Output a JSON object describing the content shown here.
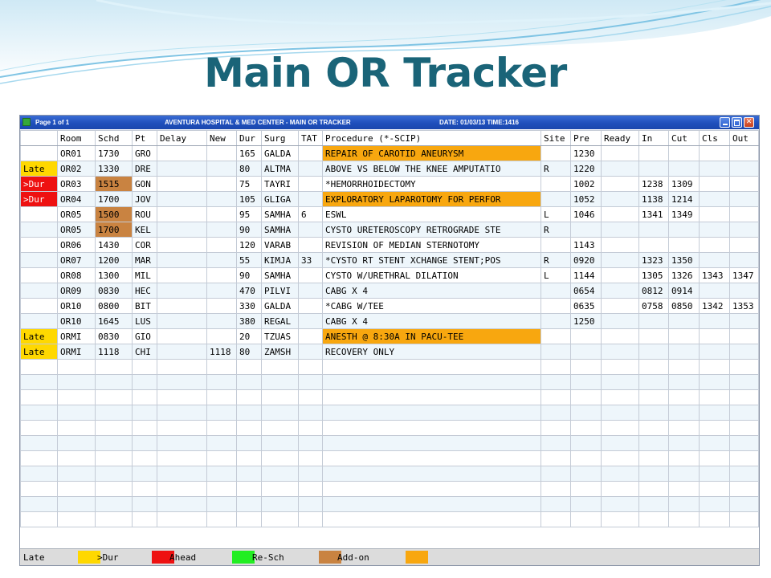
{
  "slide_title": "Main OR Tracker",
  "window": {
    "page_label": "Page 1 of 1",
    "app_title": "AVENTURA HOSPITAL & MED CENTER - MAIN OR TRACKER",
    "date_time": "DATE: 01/03/13   TIME:1416",
    "minimize_icon": "minimize-icon",
    "maximize_icon": "maximize-icon",
    "close_icon": "close-icon",
    "close_glyph": "✕"
  },
  "colors": {
    "late": "#ffd800",
    "over_duration": "#ee1111",
    "ahead": "#22ee22",
    "re_sch": "#c98341",
    "add_on": "#f8a70f",
    "title": "#1a6478",
    "titlebar": "#1f4fbc"
  },
  "columns": [
    "",
    "Room",
    "Schd",
    "Pt",
    "Delay",
    "New",
    "Dur",
    "Surg",
    "TAT",
    "Procedure (*-SCIP)",
    "Site",
    "Pre",
    "Ready",
    "In",
    "Cut",
    "Cls",
    "Out"
  ],
  "rows": [
    {
      "status": "",
      "room": "OR01",
      "schd": "1730",
      "pt": "GRO",
      "delay": "",
      "new": "",
      "dur": "165",
      "surg": "GALDA",
      "tat": "",
      "procedure": "REPAIR OF CAROTID ANEURYSM",
      "site": "",
      "pre": "1230",
      "ready": "",
      "in": "",
      "cut": "",
      "cls": "",
      "out": "",
      "status_color": "",
      "schd_color": "",
      "proc_color": "add_on"
    },
    {
      "status": "Late",
      "room": "OR02",
      "schd": "1330",
      "pt": "DRE",
      "delay": "",
      "new": "",
      "dur": "80",
      "surg": "ALTMA",
      "tat": "",
      "procedure": "ABOVE VS BELOW THE KNEE AMPUTATIO",
      "site": "R",
      "pre": "1220",
      "ready": "",
      "in": "",
      "cut": "",
      "cls": "",
      "out": "",
      "status_color": "late",
      "schd_color": "",
      "proc_color": ""
    },
    {
      "status": ">Dur",
      "room": "OR03",
      "schd": "1515",
      "pt": "GON",
      "delay": "",
      "new": "",
      "dur": "75",
      "surg": "TAYRI",
      "tat": "",
      "procedure": "*HEMORRHOIDECTOMY",
      "site": "",
      "pre": "1002",
      "ready": "",
      "in": "1238",
      "cut": "1309",
      "cls": "",
      "out": "",
      "status_color": "over_duration",
      "schd_color": "re_sch",
      "proc_color": ""
    },
    {
      "status": ">Dur",
      "room": "OR04",
      "schd": "1700",
      "pt": "JOV",
      "delay": "",
      "new": "",
      "dur": "105",
      "surg": "GLIGA",
      "tat": "",
      "procedure": "EXPLORATORY LAPAROTOMY FOR PERFOR",
      "site": "",
      "pre": "1052",
      "ready": "",
      "in": "1138",
      "cut": "1214",
      "cls": "",
      "out": "",
      "status_color": "over_duration",
      "schd_color": "",
      "proc_color": "add_on"
    },
    {
      "status": "",
      "room": "OR05",
      "schd": "1500",
      "pt": "ROU",
      "delay": "",
      "new": "",
      "dur": "95",
      "surg": "SAMHA",
      "tat": "6",
      "procedure": "ESWL",
      "site": "L",
      "pre": "1046",
      "ready": "",
      "in": "1341",
      "cut": "1349",
      "cls": "",
      "out": "",
      "status_color": "",
      "schd_color": "re_sch",
      "proc_color": ""
    },
    {
      "status": "",
      "room": "OR05",
      "schd": "1700",
      "pt": "KEL",
      "delay": "",
      "new": "",
      "dur": "90",
      "surg": "SAMHA",
      "tat": "",
      "procedure": "CYSTO URETEROSCOPY RETROGRADE STE",
      "site": "R",
      "pre": "",
      "ready": "",
      "in": "",
      "cut": "",
      "cls": "",
      "out": "",
      "status_color": "",
      "schd_color": "re_sch",
      "proc_color": ""
    },
    {
      "status": "",
      "room": "OR06",
      "schd": "1430",
      "pt": "COR",
      "delay": "",
      "new": "",
      "dur": "120",
      "surg": "VARAB",
      "tat": "",
      "procedure": "REVISION OF MEDIAN STERNOTOMY",
      "site": "",
      "pre": "1143",
      "ready": "",
      "in": "",
      "cut": "",
      "cls": "",
      "out": "",
      "status_color": "",
      "schd_color": "",
      "proc_color": ""
    },
    {
      "status": "",
      "room": "OR07",
      "schd": "1200",
      "pt": "MAR",
      "delay": "",
      "new": "",
      "dur": "55",
      "surg": "KIMJA",
      "tat": "33",
      "procedure": "*CYSTO RT STENT XCHANGE STENT;POS",
      "site": "R",
      "pre": "0920",
      "ready": "",
      "in": "1323",
      "cut": "1350",
      "cls": "",
      "out": "",
      "status_color": "",
      "schd_color": "",
      "proc_color": ""
    },
    {
      "status": "",
      "room": "OR08",
      "schd": "1300",
      "pt": "MIL",
      "delay": "",
      "new": "",
      "dur": "90",
      "surg": "SAMHA",
      "tat": "",
      "procedure": "CYSTO W/URETHRAL DILATION",
      "site": "L",
      "pre": "1144",
      "ready": "",
      "in": "1305",
      "cut": "1326",
      "cls": "1343",
      "out": "1347",
      "status_color": "",
      "schd_color": "",
      "proc_color": ""
    },
    {
      "status": "",
      "room": "OR09",
      "schd": "0830",
      "pt": "HEC",
      "delay": "",
      "new": "",
      "dur": "470",
      "surg": "PILVI",
      "tat": "",
      "procedure": "CABG X 4",
      "site": "",
      "pre": "0654",
      "ready": "",
      "in": "0812",
      "cut": "0914",
      "cls": "",
      "out": "",
      "status_color": "",
      "schd_color": "",
      "proc_color": ""
    },
    {
      "status": "",
      "room": "OR10",
      "schd": "0800",
      "pt": "BIT",
      "delay": "",
      "new": "",
      "dur": "330",
      "surg": "GALDA",
      "tat": "",
      "procedure": "*CABG W/TEE",
      "site": "",
      "pre": "0635",
      "ready": "",
      "in": "0758",
      "cut": "0850",
      "cls": "1342",
      "out": "1353",
      "status_color": "",
      "schd_color": "",
      "proc_color": ""
    },
    {
      "status": "",
      "room": "OR10",
      "schd": "1645",
      "pt": "LUS",
      "delay": "",
      "new": "",
      "dur": "380",
      "surg": "REGAL",
      "tat": "",
      "procedure": "CABG X 4",
      "site": "",
      "pre": "1250",
      "ready": "",
      "in": "",
      "cut": "",
      "cls": "",
      "out": "",
      "status_color": "",
      "schd_color": "",
      "proc_color": ""
    },
    {
      "status": "Late",
      "room": "ORMI",
      "schd": "0830",
      "pt": "GIO",
      "delay": "",
      "new": "",
      "dur": "20",
      "surg": "TZUAS",
      "tat": "",
      "procedure": "ANESTH @ 8:30A IN PACU-TEE",
      "site": "",
      "pre": "",
      "ready": "",
      "in": "",
      "cut": "",
      "cls": "",
      "out": "",
      "status_color": "late",
      "schd_color": "",
      "proc_color": "add_on"
    },
    {
      "status": "Late",
      "room": "ORMI",
      "schd": "1118",
      "pt": "CHI",
      "delay": "",
      "new": "1118",
      "dur": "80",
      "surg": "ZAMSH",
      "tat": "",
      "procedure": "RECOVERY ONLY",
      "site": "",
      "pre": "",
      "ready": "",
      "in": "",
      "cut": "",
      "cls": "",
      "out": "",
      "status_color": "late",
      "schd_color": "",
      "proc_color": ""
    }
  ],
  "legend": [
    {
      "label": "Late",
      "color_key": "late"
    },
    {
      "label": ">Dur",
      "color_key": "over_duration"
    },
    {
      "label": "Ahead",
      "color_key": "ahead"
    },
    {
      "label": "Re-Sch",
      "color_key": "re_sch"
    },
    {
      "label": "Add-on",
      "color_key": "add_on"
    }
  ]
}
